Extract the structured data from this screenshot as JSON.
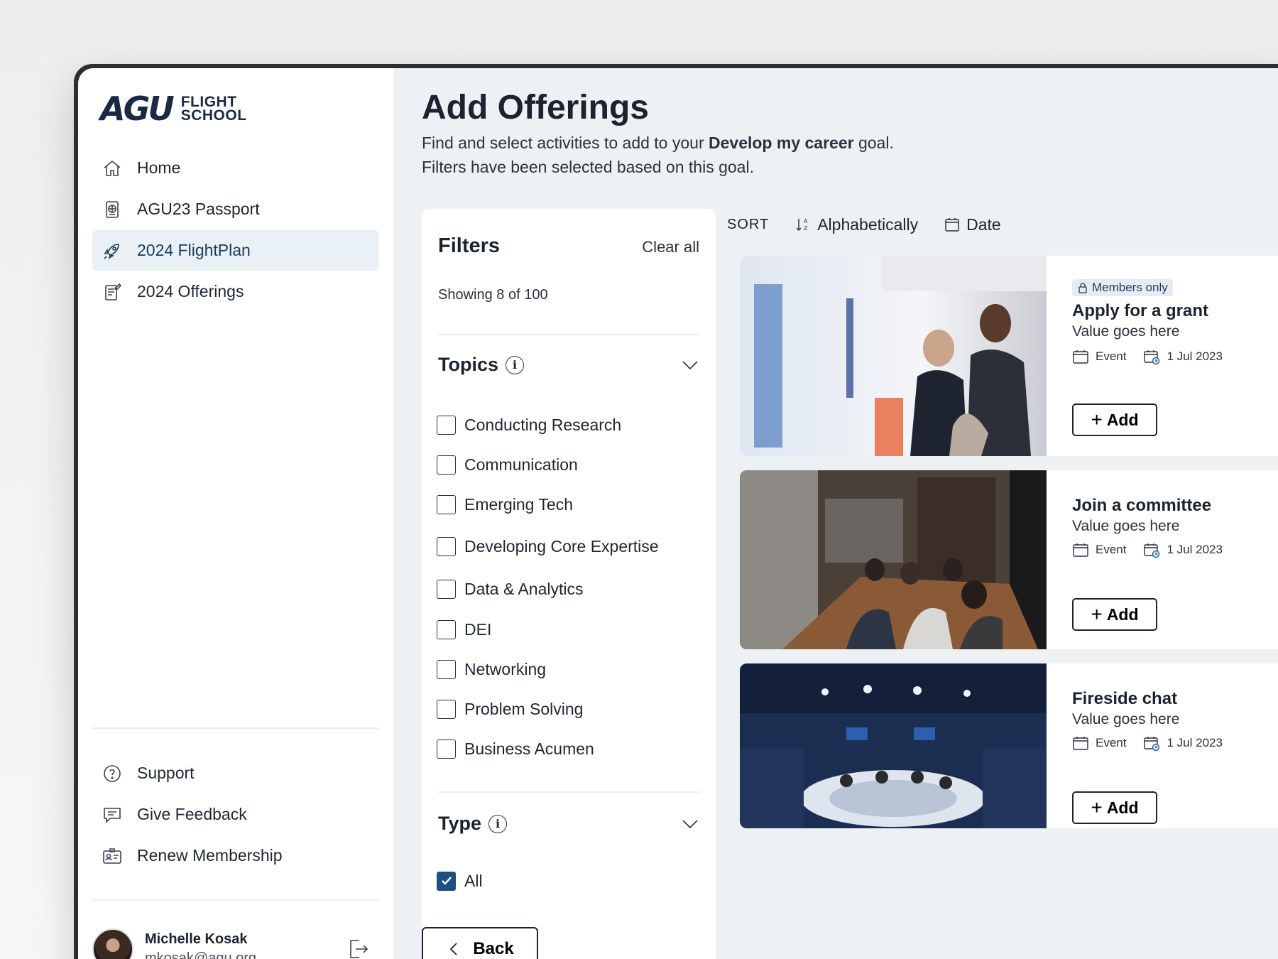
{
  "sidebar": {
    "logo_mark": "AGU",
    "logo_line1": "FLIGHT",
    "logo_line2": "SCHOOL",
    "items": [
      {
        "label": "Home",
        "icon": "home-icon"
      },
      {
        "label": "AGU23 Passport",
        "icon": "passport-icon"
      },
      {
        "label": "2024 FlightPlan",
        "icon": "rocket-icon",
        "active": true
      },
      {
        "label": "2024 Offerings",
        "icon": "document-icon"
      }
    ],
    "bottom_items": [
      {
        "label": "Support",
        "icon": "help-icon"
      },
      {
        "label": "Give Feedback",
        "icon": "feedback-icon"
      },
      {
        "label": "Renew Membership",
        "icon": "id-card-icon"
      }
    ],
    "user": {
      "name": "Michelle Kosak",
      "email": "mkosak@agu.org"
    }
  },
  "main": {
    "title": "Add Offerings",
    "desc_pre": "Find and select activities to add to your ",
    "desc_bold": "Develop my career",
    "desc_post": " goal.",
    "desc_line2": "Filters have been selected based on this goal.",
    "back_label": "Back"
  },
  "filters": {
    "title": "Filters",
    "clear_all": "Clear all",
    "showing": "Showing 8 of 100",
    "topics_title": "Topics",
    "topics": [
      "Conducting Research",
      "Communication",
      "Emerging Tech",
      "Developing Core Expertise",
      "Data & Analytics",
      "DEI",
      "Networking",
      "Problem Solving",
      "Business Acumen"
    ],
    "type_title": "Type",
    "type_options": [
      {
        "label": "All",
        "checked": true
      }
    ]
  },
  "sort": {
    "label": "SORT",
    "alpha": "Alphabetically",
    "date": "Date"
  },
  "cards": [
    {
      "badge": "Members only",
      "title": "Apply for a grant",
      "value": "Value goes here",
      "type": "Event",
      "date": "1 Jul 2023",
      "add": "Add"
    },
    {
      "badge": "",
      "title": "Join a committee",
      "value": "Value goes here",
      "type": "Event",
      "date": "1 Jul 2023",
      "add": "Add"
    },
    {
      "badge": "",
      "title": "Fireside chat",
      "value": "Value goes here",
      "type": "Event",
      "date": "1 Jul 2023",
      "add": "Add"
    }
  ],
  "colors": {
    "brand_navy": "#1b2a44",
    "active_bg": "#eaf1f6",
    "checkbox_checked": "#1f4f80",
    "badge_bg": "#e4ecf5"
  }
}
